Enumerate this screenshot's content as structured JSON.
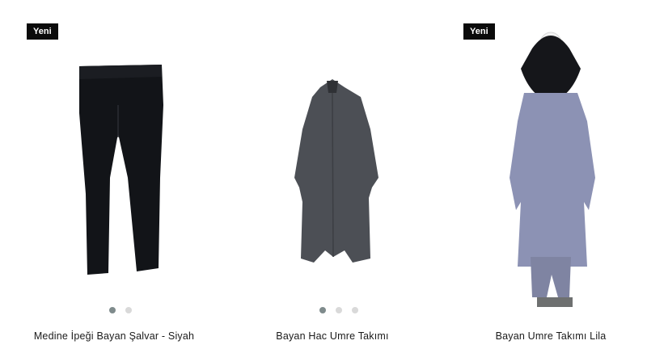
{
  "products": [
    {
      "badge": "Yeni",
      "title": "Medine İpeği Bayan Şalvar - Siyah",
      "image_icon": "black-trousers-image",
      "carousel_slides": 2,
      "active_slide": 1
    },
    {
      "badge": "",
      "title": "Bayan Hac Umre Takımı",
      "image_icon": "grey-long-coat-image",
      "carousel_slides": 3,
      "active_slide": 1
    },
    {
      "badge": "Yeni",
      "title": "Bayan Umre Takımı Lila",
      "image_icon": "lilac-hijab-set-image",
      "carousel_slides": 0,
      "active_slide": 0
    }
  ],
  "colors": {
    "badge_bg": "#0b0b0b",
    "dot_active": "#7f8b8c",
    "dot_inactive": "#d9d9d9"
  }
}
